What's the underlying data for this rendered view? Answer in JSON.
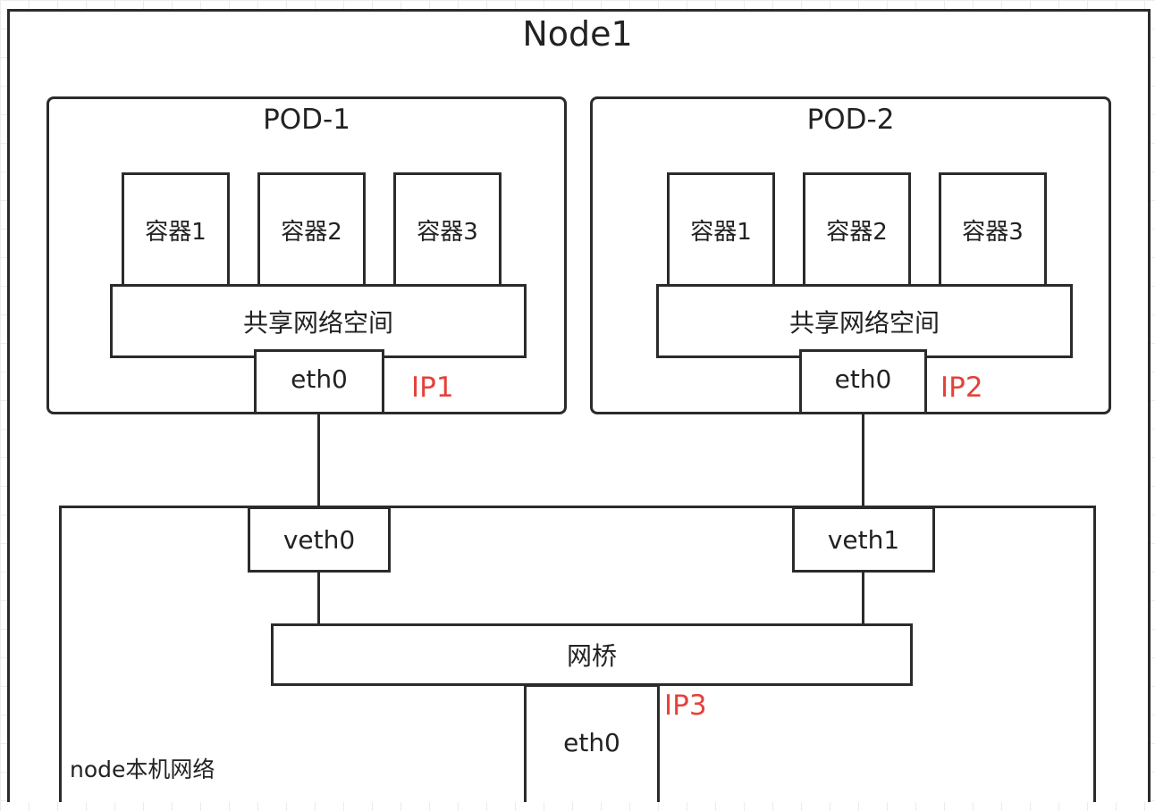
{
  "node": {
    "title": "Node1",
    "local_network_label": "node本机网络"
  },
  "pods": [
    {
      "name": "POD-1",
      "containers": [
        "容器1",
        "容器2",
        "容器3"
      ],
      "shared_ns": "共享网络空间",
      "iface": "eth0",
      "ip": "IP1"
    },
    {
      "name": "POD-2",
      "containers": [
        "容器1",
        "容器2",
        "容器3"
      ],
      "shared_ns": "共享网络空间",
      "iface": "eth0",
      "ip": "IP2"
    }
  ],
  "host": {
    "veth": [
      "veth0",
      "veth1"
    ],
    "bridge": "网桥",
    "iface": "eth0",
    "ip": "IP3"
  },
  "colors": {
    "ip_label": "#e5413b",
    "stroke": "#2b2b2b"
  }
}
